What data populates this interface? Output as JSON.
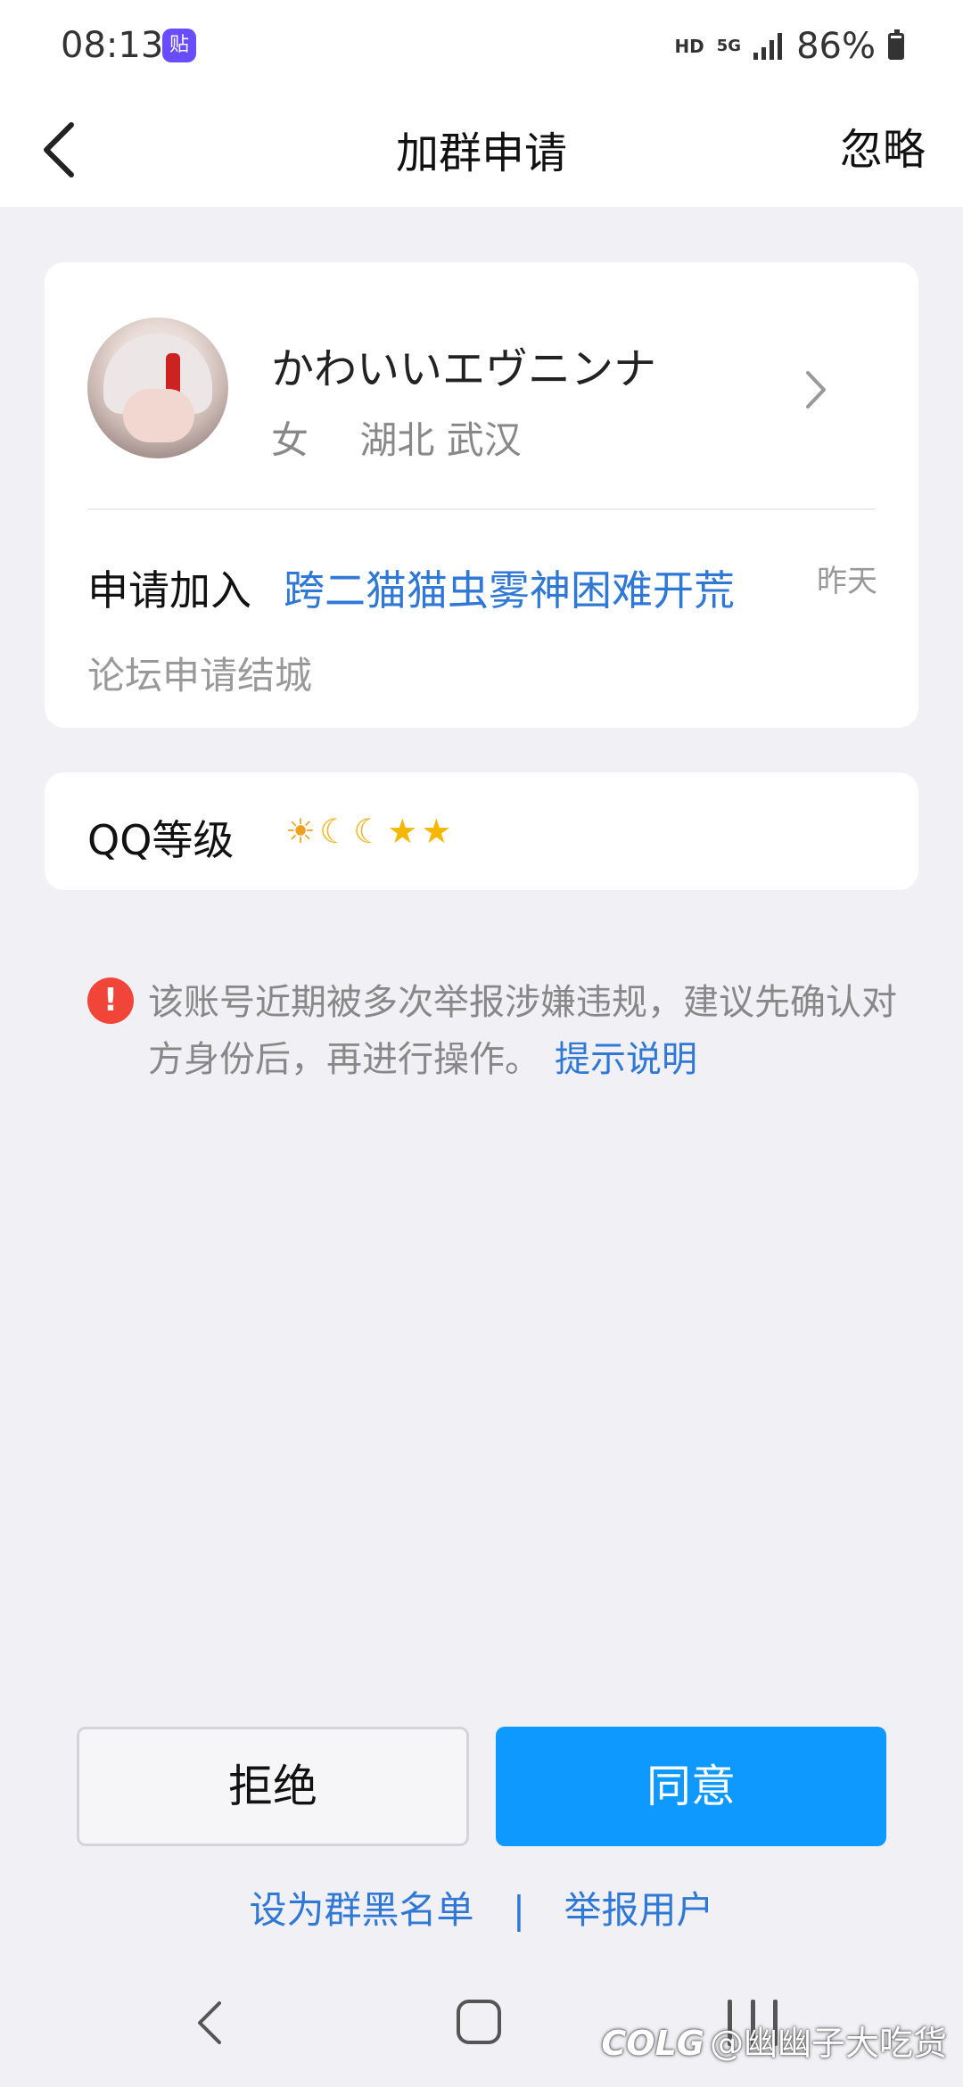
{
  "status_bar": {
    "time": "08:13",
    "app_icon_label": "贴",
    "network_hd": "HD",
    "network_5g": "5G",
    "battery": "86%"
  },
  "nav": {
    "title": "加群申请",
    "ignore_label": "忽略"
  },
  "applicant": {
    "name": "かわいいエヴニンナ",
    "gender": "女",
    "location": "湖北 武汉",
    "apply_label": "申请加入",
    "group_name": "跨二猫猫虫雾神困难开荒",
    "time": "昨天",
    "note": "论坛申请结城"
  },
  "level": {
    "label": "QQ等级",
    "icons": [
      "sun-icon",
      "moon-icon",
      "moon-icon",
      "star-icon",
      "star-icon"
    ]
  },
  "warning": {
    "text": "该账号近期被多次举报涉嫌违规，建议先确认对方身份后，再进行操作。",
    "link": "提示说明"
  },
  "actions": {
    "reject": "拒绝",
    "accept": "同意",
    "blacklist": "设为群黑名单",
    "separator": "|",
    "report": "举报用户"
  },
  "watermark": {
    "logo": "COLG",
    "text": "@幽幽子大吃货"
  },
  "colors": {
    "accent": "#0d99ff",
    "link": "#2f78d6",
    "warning": "#f2453a"
  }
}
